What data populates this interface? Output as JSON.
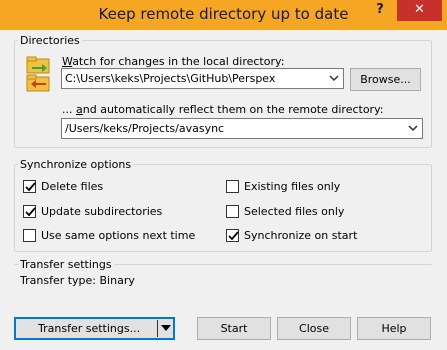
{
  "window": {
    "title": "Keep remote directory up to date",
    "help_glyph": "?",
    "close_glyph": "✕"
  },
  "directories": {
    "group_label": "Directories",
    "local_label_key": "W",
    "local_label_rest": "atch for changes in the local directory:",
    "local_value": "C:\\Users\\keks\\Projects\\GitHub\\Perspex",
    "browse_label": "Browse...",
    "remote_label_prefix": "... ",
    "remote_label_key": "a",
    "remote_label_rest": "nd automatically reflect them on the remote directory:",
    "remote_value": "/Users/keks/Projects/avasync"
  },
  "sync_options": {
    "group_label": "Synchronize options",
    "items": [
      {
        "label": "Delete files",
        "checked": true
      },
      {
        "label": "Existing files only",
        "checked": false
      },
      {
        "label": "Update subdirectories",
        "checked": true
      },
      {
        "label": "Selected files only",
        "checked": false
      },
      {
        "label": "Use same options next time",
        "checked": false
      },
      {
        "label": "Synchronize on start",
        "checked": true
      }
    ]
  },
  "transfer": {
    "group_label": "Transfer settings",
    "type_text": "Transfer type: Binary"
  },
  "buttons": {
    "transfer_settings": "Transfer settings...",
    "start": "Start",
    "close": "Close",
    "help": "Help"
  },
  "icons": {
    "sync_folder": "sync-folder-icon"
  },
  "colors": {
    "titlebar": "#f5a623",
    "close_button": "#c7302b",
    "default_button_border": "#0078d7"
  }
}
